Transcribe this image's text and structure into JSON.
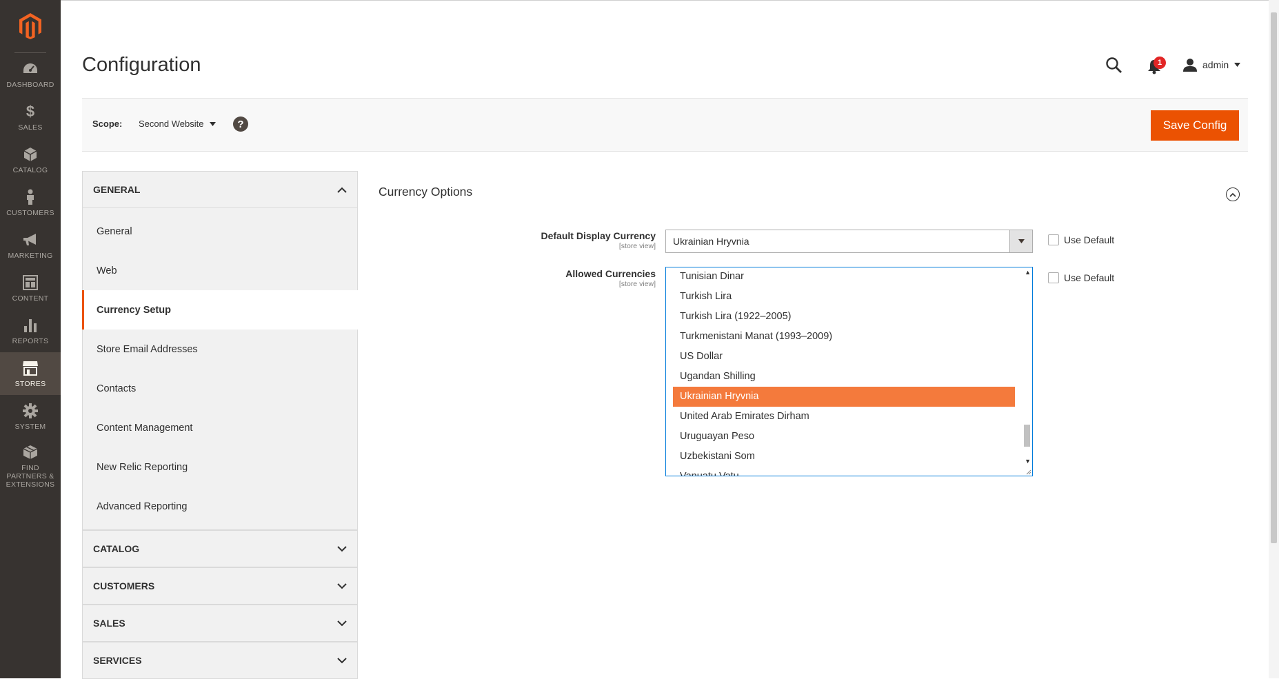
{
  "nav": {
    "items": [
      {
        "label": "DASHBOARD",
        "icon": "dashboard-icon"
      },
      {
        "label": "$",
        "icon": "dollar-icon"
      },
      {
        "label": "SALES",
        "icon": "sales-icon"
      },
      {
        "label": "CATALOG",
        "icon": "cube-icon"
      },
      {
        "label": "CUSTOMERS",
        "icon": "person-icon"
      },
      {
        "label": "MARKETING",
        "icon": "megaphone-icon"
      },
      {
        "label": "CONTENT",
        "icon": "layout-icon"
      },
      {
        "label": "REPORTS",
        "icon": "bar-chart-icon"
      },
      {
        "label": "STORES",
        "icon": "store-icon"
      },
      {
        "label": "SYSTEM",
        "icon": "gear-icon"
      },
      {
        "label": "FIND PARTNERS & EXTENSIONS",
        "icon": "boxes-icon"
      }
    ],
    "labels": {
      "dashboard": "DASHBOARD",
      "sales": "SALES",
      "catalog": "CATALOG",
      "customers": "CUSTOMERS",
      "marketing": "MARKETING",
      "content": "CONTENT",
      "reports": "REPORTS",
      "stores": "STORES",
      "system": "SYSTEM",
      "partners": "FIND PARTNERS & EXTENSIONS"
    }
  },
  "header": {
    "title": "Configuration",
    "notification_count": "1",
    "user": "admin"
  },
  "scope": {
    "label": "Scope:",
    "value": "Second Website",
    "help": "?",
    "save_label": "Save Config"
  },
  "tabs": {
    "general": {
      "title": "GENERAL",
      "items": [
        "General",
        "Web",
        "Currency Setup",
        "Store Email Addresses",
        "Contacts",
        "Content Management",
        "New Relic Reporting",
        "Advanced Reporting"
      ]
    },
    "catalog": "CATALOG",
    "customers": "CUSTOMERS",
    "sales": "SALES",
    "services": "SERVICES"
  },
  "main": {
    "section_title": "Currency Options",
    "default_display": {
      "label": "Default Display Currency",
      "scope": "[store view]",
      "value": "Ukrainian Hryvnia",
      "use_default": "Use Default"
    },
    "allowed": {
      "label": "Allowed Currencies",
      "scope": "[store view]",
      "use_default": "Use Default",
      "options": [
        "Tunisian Dinar",
        "Turkish Lira",
        "Turkish Lira (1922–2005)",
        "Turkmenistani Manat (1993–2009)",
        "US Dollar",
        "Ugandan Shilling",
        "Ukrainian Hryvnia",
        "United Arab Emirates Dirham",
        "Uruguayan Peso",
        "Uzbekistani Som",
        "Vanuatu Vatu"
      ],
      "selected": "Ukrainian Hryvnia"
    }
  },
  "colors": {
    "sidebar_bg": "#373330",
    "active_bg": "#514943",
    "accent": "#eb5202",
    "selected_option": "#f47a3c"
  }
}
